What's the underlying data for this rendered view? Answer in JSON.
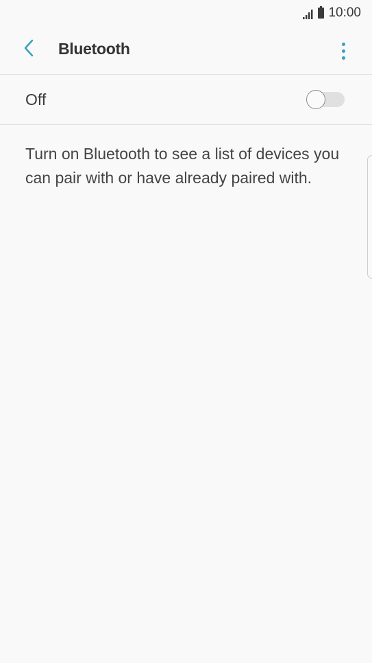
{
  "status_bar": {
    "time": "10:00"
  },
  "header": {
    "title": "Bluetooth"
  },
  "bluetooth_toggle": {
    "label": "Off",
    "state": "off"
  },
  "description": "Turn on Bluetooth to see a list of devices you can pair with or have already paired with.",
  "colors": {
    "accent": "#3aa0c0",
    "background": "#f9f9f9",
    "divider": "#e1e1e1"
  },
  "icons": {
    "back": "chevron-left-icon",
    "more": "more-vertical-icon",
    "signal": "signal-icon",
    "battery": "battery-icon"
  }
}
